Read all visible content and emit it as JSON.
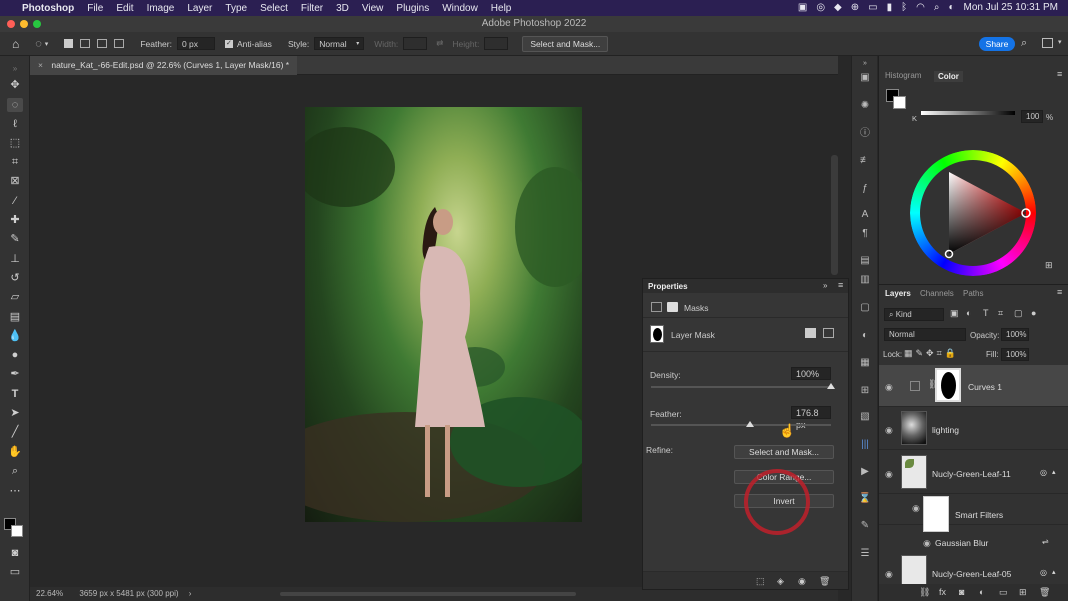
{
  "menubar": {
    "app": "Photoshop",
    "items": [
      "File",
      "Edit",
      "Image",
      "Layer",
      "Type",
      "Select",
      "Filter",
      "3D",
      "View",
      "Plugins",
      "Window",
      "Help"
    ],
    "clock": "Mon Jul 25  10:31 PM"
  },
  "window": {
    "title": "Adobe Photoshop 2022"
  },
  "options": {
    "feather_label": "Feather:",
    "feather_value": "0 px",
    "antialias_label": "Anti-alias",
    "style_label": "Style:",
    "style_value": "Normal",
    "width_label": "Width:",
    "height_label": "Height:",
    "select_mask": "Select and Mask...",
    "share": "Share"
  },
  "document": {
    "tab": "nature_Kat_-66-Edit.psd @ 22.6% (Curves 1, Layer Mask/16) *",
    "close": "×"
  },
  "status": {
    "zoom": "22.64%",
    "size": "3659 px x 5481 px (300 ppi)"
  },
  "properties": {
    "title": "Properties",
    "masks": "Masks",
    "layer_mask": "Layer Mask",
    "density_label": "Density:",
    "density_value": "100%",
    "density": 1.0,
    "feather_label": "Feather:",
    "feather_value": "176.8 px",
    "feather_fraction": 0.55,
    "refine_label": "Refine:",
    "select_mask": "Select and Mask...",
    "color_range": "Color Range...",
    "invert": "Invert"
  },
  "color_panel": {
    "tabs": [
      "Histogram",
      "Color"
    ],
    "k_label": "K",
    "k_value": "100",
    "k_unit": "%",
    "wheel_colors": [
      "#ff0000",
      "#ff00ff",
      "#0000ff",
      "#00ffff",
      "#00ff00",
      "#ffff00"
    ]
  },
  "layers_panel": {
    "tabs": [
      "Layers",
      "Channels",
      "Paths"
    ],
    "kind": "Kind",
    "blend": "Normal",
    "opacity_label": "Opacity:",
    "opacity": "100%",
    "lock_label": "Lock:",
    "fill_label": "Fill:",
    "fill": "100%",
    "layers": [
      {
        "name": "Curves 1"
      },
      {
        "name": "lighting"
      },
      {
        "name": "Nucly-Green-Leaf-11"
      },
      {
        "name": "Smart Filters"
      },
      {
        "name": "Gaussian Blur"
      },
      {
        "name": "Nucly-Green-Leaf-05"
      }
    ]
  },
  "colors": {
    "menubar": "#2b1f52",
    "accent": "#1473e6",
    "highlight": "#c0202a"
  }
}
